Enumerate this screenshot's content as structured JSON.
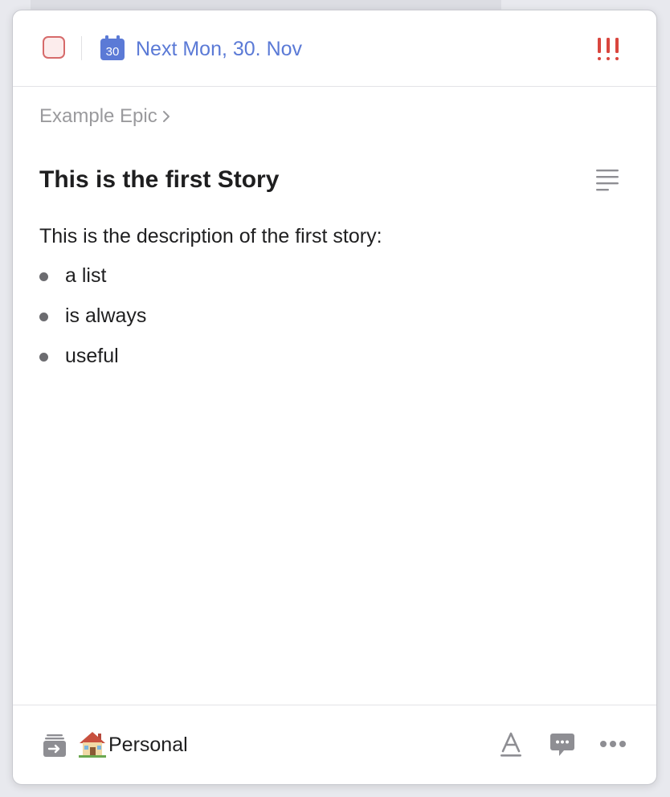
{
  "header": {
    "due_date_label": "Next Mon, 30. Nov",
    "calendar_day": "30",
    "priority_label": "!!!"
  },
  "breadcrumb": {
    "epic": "Example Epic"
  },
  "story": {
    "title": "This is the first Story",
    "description": "This is the description of the first story:",
    "bullets": [
      "a list",
      "is always",
      "useful"
    ]
  },
  "footer": {
    "list_emoji": "house-icon",
    "list_name": "Personal"
  },
  "colors": {
    "accent": "#5b7ad6",
    "priority": "#d9463e",
    "checkbox_border": "#d66a6a",
    "checkbox_fill": "#fcecec",
    "muted_icon": "#8e8e93"
  }
}
